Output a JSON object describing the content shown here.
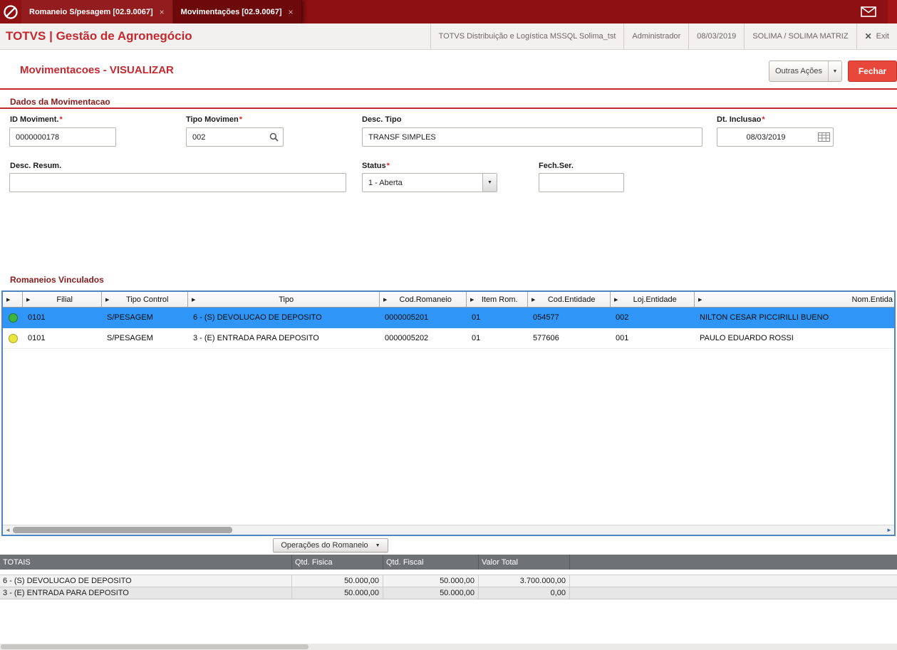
{
  "colors": {
    "topbar_bg": "#8e1013",
    "active_tab_bg": "#6d090b",
    "brand_red": "#c5282f",
    "section_title_red": "#8a1a1c",
    "fechar_button_bg": "#e8483b",
    "selected_row_bg": "#2f96f8",
    "totals_header_bg": "#6f7275",
    "status_green": "#3eb33e",
    "status_yellow": "#eae63c"
  },
  "icons": {
    "tab_close": "×",
    "exit_x": "✕",
    "caret_down": "▼",
    "column_arrow": "▶",
    "scroll_left": "◄",
    "scroll_right": "►"
  },
  "topbar": {
    "tabs": [
      {
        "label": "Romaneio S/pesagem [02.9.0067]",
        "close_label": "×"
      },
      {
        "label": "Movimentações [02.9.0067]",
        "close_label": "×"
      }
    ]
  },
  "header": {
    "brand": "TOTVS | Gestão de Agronegócio",
    "environment": "TOTVS Distribuição e Logística MSSQL Solima_tst",
    "user": "Administrador",
    "date": "08/03/2019",
    "company": "SOLIMA / SOLIMA MATRIZ",
    "exit_label": "Exit"
  },
  "toolbar": {
    "title": "Movimentacoes - VISUALIZAR",
    "outras_acoes_label": "Outras Ações",
    "fechar_label": "Fechar"
  },
  "form": {
    "section_title": "Dados da Movimentacao",
    "id_moviment": {
      "label": "ID Moviment.",
      "required_mark": "*",
      "value": "0000000178"
    },
    "tipo_movimen": {
      "label": "Tipo Movimen",
      "required_mark": "*",
      "value": "002"
    },
    "desc_tipo": {
      "label": "Desc. Tipo",
      "value": "TRANSF SIMPLES"
    },
    "dt_inclusao": {
      "label": "Dt. Inclusao",
      "required_mark": "*",
      "value": "08/03/2019"
    },
    "desc_resum": {
      "label": "Desc. Resum.",
      "value": ""
    },
    "status": {
      "label": "Status",
      "required_mark": "*",
      "value": "1 - Aberta"
    },
    "fech_ser": {
      "label": "Fech.Ser.",
      "value": ""
    }
  },
  "grid": {
    "section_title": "Romaneios Vinculados",
    "columns": {
      "filial": "Filial",
      "tipo_control": "Tipo Control",
      "tipo": "Tipo",
      "cod_romaneio": "Cod.Romaneio",
      "item_rom": "Item Rom.",
      "cod_entidade": "Cod.Entidade",
      "loj_entidade": "Loj.Entidade",
      "nom_entidade": "Nom.Entida"
    },
    "rows": [
      {
        "status": "green",
        "filial": "0101",
        "tipo_control": "S/PESAGEM",
        "tipo": "6 - (S) DEVOLUCAO DE DEPOSITO",
        "cod_romaneio": "0000005201",
        "item_rom": "01",
        "cod_entidade": "054577",
        "loj_entidade": "002",
        "nom_entidade": "NILTON CESAR PICCIRILLI BUENO"
      },
      {
        "status": "yellow",
        "filial": "0101",
        "tipo_control": "S/PESAGEM",
        "tipo": "3 - (E) ENTRADA PARA DEPOSITO",
        "cod_romaneio": "0000005202",
        "item_rom": "01",
        "cod_entidade": "577606",
        "loj_entidade": "001",
        "nom_entidade": "PAULO EDUARDO ROSSI"
      }
    ]
  },
  "totais": {
    "operacoes_button_label": "Operações do Romaneio",
    "columns": {
      "totais": "TOTAIS",
      "qtd_fisica": "Qtd. Fisica",
      "qtd_fiscal": "Qtd. Fiscal",
      "valor_total": "Valor Total"
    },
    "rows": [
      {
        "label": "6 - (S) DEVOLUCAO DE DEPOSITO",
        "qtd_fisica": "50.000,00",
        "qtd_fiscal": "50.000,00",
        "valor_total": "3.700.000,00"
      },
      {
        "label": "3 - (E) ENTRADA PARA DEPOSITO",
        "qtd_fisica": "50.000,00",
        "qtd_fiscal": "50.000,00",
        "valor_total": "0,00"
      }
    ]
  }
}
